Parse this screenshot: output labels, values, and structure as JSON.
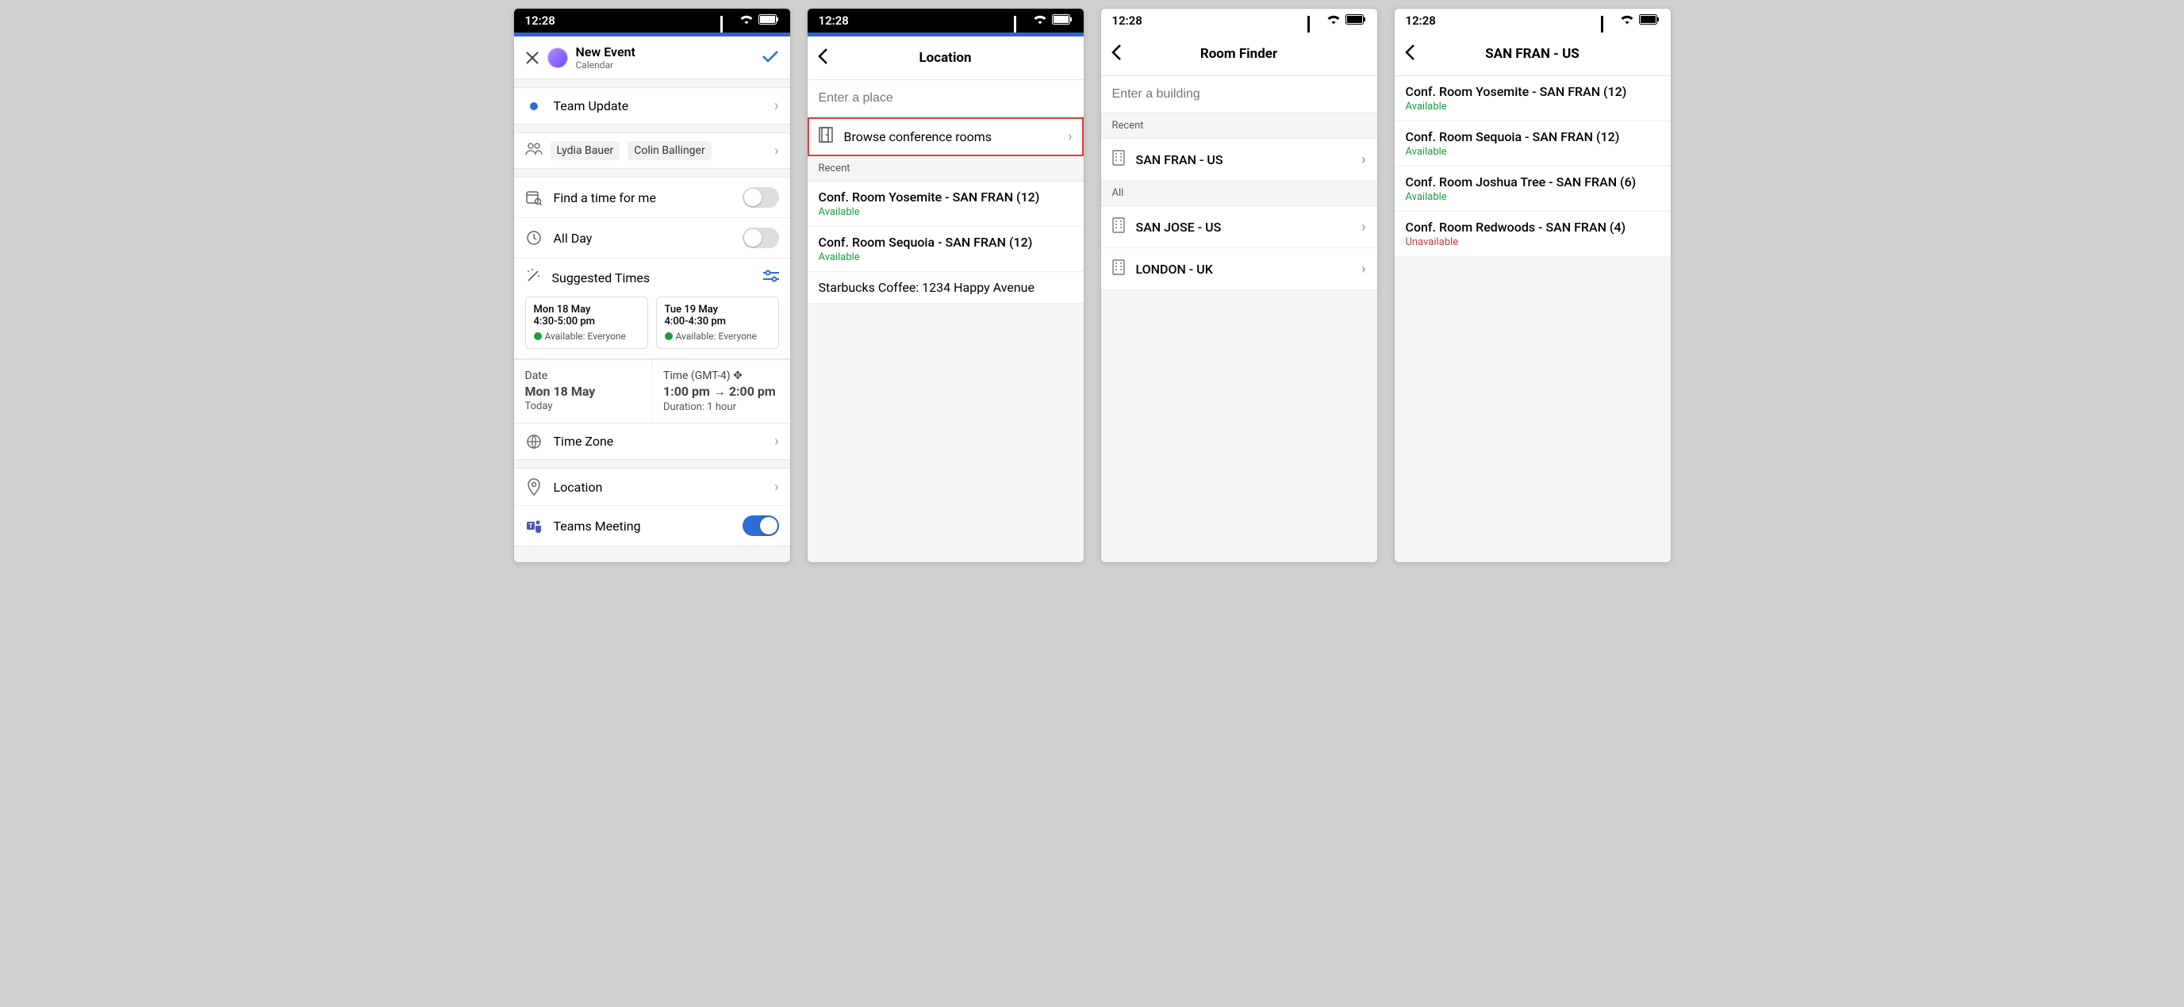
{
  "status": {
    "time": "12:28"
  },
  "screen1": {
    "header": {
      "title": "New Event",
      "subtitle": "Calendar"
    },
    "event_title": "Team Update",
    "people": [
      "Lydia Bauer",
      "Colin Ballinger"
    ],
    "find_time": "Find a time for me",
    "all_day": "All Day",
    "suggested_label": "Suggested Times",
    "suggestions": [
      {
        "date": "Mon 18 May",
        "time": "4:30-5:00 pm",
        "avail": "Available: Everyone"
      },
      {
        "date": "Tue 19 May",
        "time": "4:00-4:30 pm",
        "avail": "Available: Everyone"
      }
    ],
    "datetime": {
      "date_label": "Date",
      "date": "Mon 18 May",
      "today": "Today",
      "time_label": "Time (GMT-4)",
      "time_from": "1:00 pm",
      "time_to": "2:00 pm",
      "duration": "Duration: 1 hour"
    },
    "timezone": "Time Zone",
    "location": "Location",
    "teams": "Teams Meeting"
  },
  "screen2": {
    "title": "Location",
    "placeholder": "Enter a place",
    "browse": "Browse conference rooms",
    "recent_label": "Recent",
    "rooms": [
      {
        "name": "Conf. Room Yosemite - SAN FRAN (12)",
        "status": "Available",
        "avail": true
      },
      {
        "name": "Conf. Room Sequoia - SAN FRAN (12)",
        "status": "Available",
        "avail": true
      }
    ],
    "other": "Starbucks Coffee: 1234 Happy Avenue"
  },
  "screen3": {
    "title": "Room Finder",
    "placeholder": "Enter a building",
    "recent_label": "Recent",
    "all_label": "All",
    "recent": [
      "SAN FRAN - US"
    ],
    "all": [
      "SAN JOSE - US",
      "LONDON - UK"
    ]
  },
  "screen4": {
    "title": "SAN FRAN - US",
    "rooms": [
      {
        "name": "Conf. Room Yosemite - SAN FRAN (12)",
        "status": "Available",
        "avail": true
      },
      {
        "name": "Conf. Room Sequoia - SAN FRAN (12)",
        "status": "Available",
        "avail": true
      },
      {
        "name": "Conf. Room Joshua Tree - SAN FRAN (6)",
        "status": "Available",
        "avail": true
      },
      {
        "name": "Conf. Room Redwoods - SAN FRAN (4)",
        "status": "Unavailable",
        "avail": false
      }
    ]
  }
}
